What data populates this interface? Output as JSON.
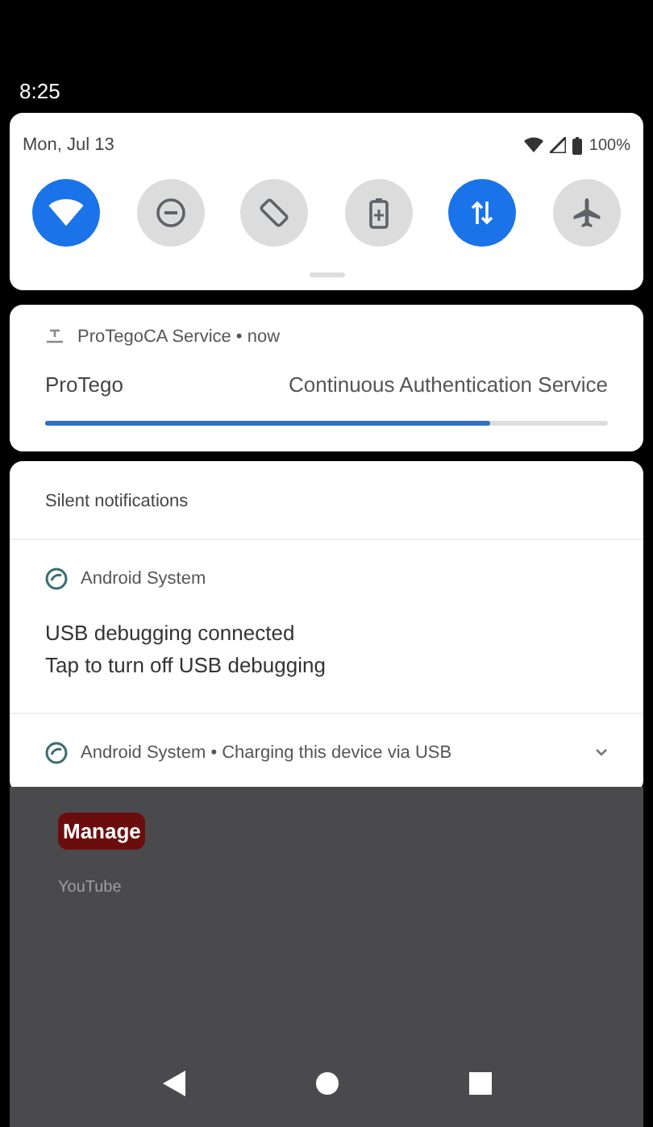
{
  "status_bar": {
    "time": "8:25"
  },
  "quick_settings": {
    "date": "Mon, Jul 13",
    "battery": "100%",
    "tiles": [
      {
        "kind": "wifi",
        "on": true
      },
      {
        "kind": "dnd",
        "on": false
      },
      {
        "kind": "rotate",
        "on": false
      },
      {
        "kind": "battery",
        "on": false
      },
      {
        "kind": "data",
        "on": true
      },
      {
        "kind": "airplane",
        "on": false
      }
    ]
  },
  "progress_notification": {
    "header": "ProTegoCA Service • now",
    "title": "ProTego",
    "text": "Continuous Authentication Service",
    "level": 0.79
  },
  "silent_section": {
    "title": "Silent notifications",
    "notifications": [
      {
        "kind": "expanded",
        "app": "Android System",
        "title": "USB debugging connected",
        "text": "Tap to turn off USB debugging"
      },
      {
        "kind": "collapsed",
        "app": "Android System • Charging this device via USB"
      }
    ]
  },
  "background": {
    "manage_button": "Manage",
    "app_label": "YouTube"
  }
}
